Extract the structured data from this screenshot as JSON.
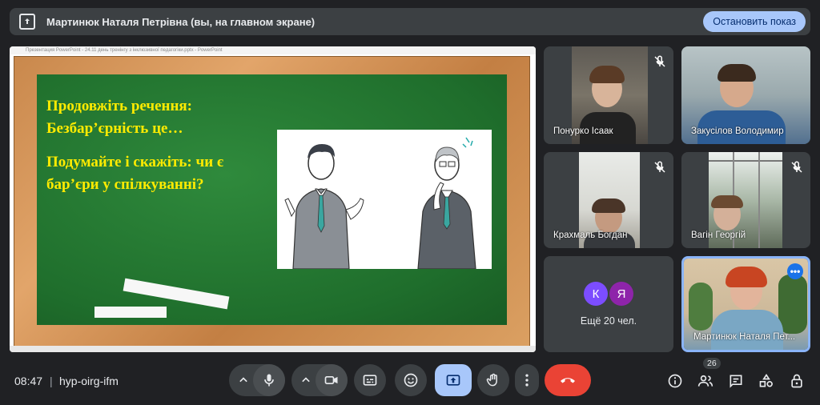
{
  "banner": {
    "title": "Мартинюк Наталя Петрівна (вы, на главном экране)",
    "stop_label": "Остановить показ"
  },
  "presentation": {
    "window_caption": "Презентация PowerPoint - 24.11 день тренінгу з інклюзивної педагогіки.pptx - PowerPoint",
    "slide": {
      "line1": "Продовжіть речення:",
      "line2": "Безбар’єрність це…",
      "line3": "Подумайте і скажіть:  чи є",
      "line4": "бар’єри у спілкуванні?"
    }
  },
  "participants": [
    {
      "name": "Понурко Ісаак",
      "muted": true
    },
    {
      "name": "Закусілов Володимир",
      "muted": false
    },
    {
      "name": "Крахмаль Богдан",
      "muted": true
    },
    {
      "name": "Вагін Георгій",
      "muted": true
    },
    {
      "name": "Мартинюк Наталя Пет...",
      "muted": false
    }
  ],
  "more": {
    "avatar1": "К",
    "avatar2": "Я",
    "label": "Ещё 20 чел."
  },
  "colors": {
    "accent": "#a8c7fa",
    "leave": "#ea4335",
    "avatar1": "#7c4dff",
    "avatar2": "#8e24aa"
  },
  "bottom": {
    "time": "08:47",
    "separator": "|",
    "meeting_code": "hyp-oirg-ifm",
    "participant_count": "26"
  },
  "icons": [
    "present-screen-icon",
    "microphone-icon",
    "camera-icon",
    "captions-icon",
    "emoji-icon",
    "present-icon",
    "raise-hand-icon",
    "more-options-icon",
    "leave-call-icon",
    "info-icon",
    "people-icon",
    "chat-icon",
    "activities-icon",
    "host-controls-icon"
  ]
}
